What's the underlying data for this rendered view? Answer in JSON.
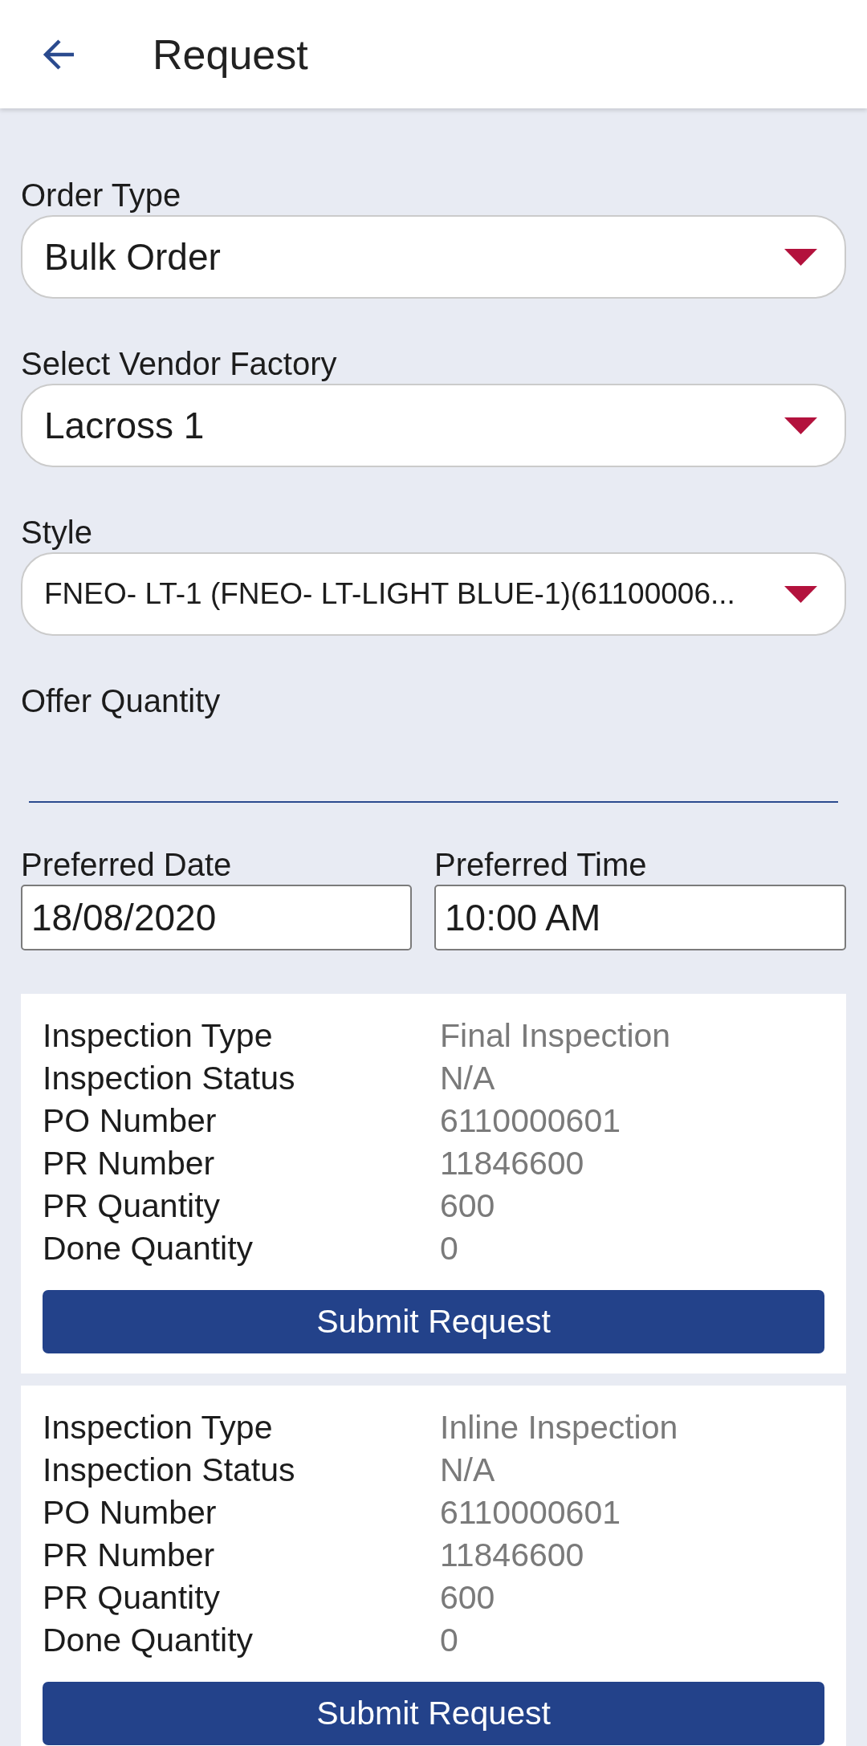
{
  "header": {
    "title": "Request"
  },
  "form": {
    "dropdowns": [
      {
        "label": "Order Type",
        "value": "Bulk Order"
      },
      {
        "label": "Select Vendor Factory",
        "value": "Lacross 1"
      },
      {
        "label": "Style",
        "value": "FNEO- LT-1 (FNEO- LT-LIGHT BLUE-1)(61100006..."
      }
    ],
    "offer_quantity": {
      "label": "Offer Quantity"
    },
    "preferred_date": {
      "label": "Preferred Date",
      "value": "18/08/2020"
    },
    "preferred_time": {
      "label": "Preferred Time",
      "value": "10:00 AM"
    }
  },
  "requests": [
    {
      "fields": [
        {
          "label": "Inspection Type",
          "value": "Final Inspection"
        },
        {
          "label": "Inspection Status",
          "value": "N/A"
        },
        {
          "label": "PO Number",
          "value": "6110000601"
        },
        {
          "label": "PR Number",
          "value": "11846600"
        },
        {
          "label": "PR Quantity",
          "value": "600"
        },
        {
          "label": "Done Quantity",
          "value": "0"
        }
      ],
      "button": "Submit Request"
    },
    {
      "fields": [
        {
          "label": "Inspection Type",
          "value": "Inline Inspection"
        },
        {
          "label": "Inspection Status",
          "value": "N/A"
        },
        {
          "label": "PO Number",
          "value": "6110000601"
        },
        {
          "label": "PR Number",
          "value": "11846600"
        },
        {
          "label": "PR Quantity",
          "value": "600"
        },
        {
          "label": "Done Quantity",
          "value": "0"
        }
      ],
      "button": "Submit Request"
    }
  ]
}
